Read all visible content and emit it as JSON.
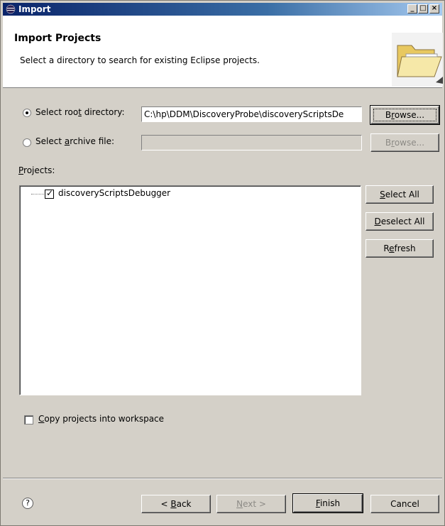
{
  "window": {
    "title": "Import"
  },
  "banner": {
    "title": "Import Projects",
    "description": "Select a directory to search for existing Eclipse projects."
  },
  "source": {
    "root_directory": {
      "label_pre": "Select roo",
      "label_u": "t",
      "label_post": " directory:",
      "selected": true,
      "value": "C:\\hp\\DDM\\DiscoveryProbe\\discoveryScriptsDe",
      "browse_pre": "B",
      "browse_u": "r",
      "browse_post": "owse..."
    },
    "archive_file": {
      "label_pre": "Select ",
      "label_u": "a",
      "label_post": "rchive file:",
      "selected": false,
      "value": "",
      "browse_pre": "B",
      "browse_u": "r",
      "browse_post": "owse..."
    }
  },
  "projects": {
    "label_u": "P",
    "label_post": "rojects:",
    "items": [
      {
        "name": "discoveryScriptsDebugger",
        "checked": true
      }
    ],
    "select_all_u": "S",
    "select_all_post": "elect All",
    "deselect_all_u": "D",
    "deselect_all_post": "eselect All",
    "refresh_pre": "R",
    "refresh_u": "e",
    "refresh_post": "fresh"
  },
  "copy_option": {
    "label_u": "C",
    "label_post": "opy projects into workspace",
    "checked": false
  },
  "footer": {
    "help": "?",
    "back_pre": "< ",
    "back_u": "B",
    "back_post": "ack",
    "next_u": "N",
    "next_post": "ext >",
    "finish_u": "F",
    "finish_post": "inish",
    "cancel": "Cancel"
  }
}
